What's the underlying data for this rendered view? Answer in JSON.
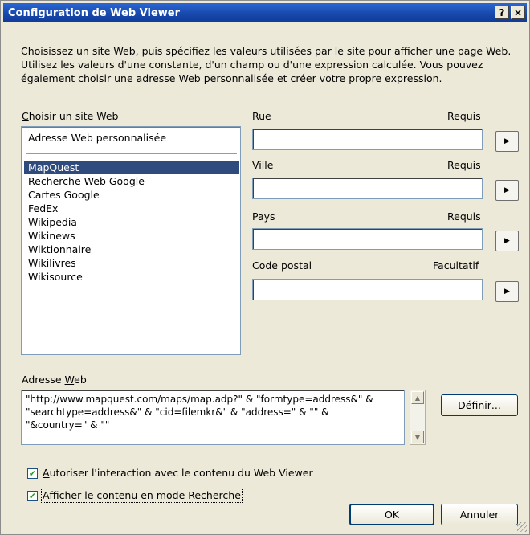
{
  "window": {
    "title": "Configuration de Web Viewer",
    "help_label": "?",
    "close_label": "×"
  },
  "intro": "Choisissez un site Web, puis spécifiez les valeurs utilisées par le site pour afficher une page Web. Utilisez les valeurs d'une constante, d'un champ ou d'une expression calculée. Vous pouvez également choisir une adresse Web personnalisée et créer votre propre expression.",
  "site_list": {
    "label_mnemonic": "C",
    "label_rest": "hoisir un site Web",
    "custom_item": "Adresse Web personnalisée",
    "selected": "MapQuest",
    "items": [
      "MapQuest",
      "Recherche Web Google",
      "Cartes Google",
      "FedEx",
      "Wikipedia",
      "Wikinews",
      "Wiktionnaire",
      "Wikilivres",
      "Wikisource"
    ]
  },
  "fields": [
    {
      "label": "Rue",
      "status": "Requis",
      "value": ""
    },
    {
      "label": "Ville",
      "status": "Requis",
      "value": ""
    },
    {
      "label": "Pays",
      "status": "Requis",
      "value": ""
    },
    {
      "label": "Code postal",
      "status": "Facultatif",
      "value": ""
    }
  ],
  "url": {
    "label_pre": "Adresse ",
    "label_mnemonic": "W",
    "label_post": "eb",
    "line1": "\"http://www.mapquest.com/maps/map.adp?\" & \"formtype=address&\" &",
    "line2": "\"searchtype=address&\" & \"cid=filemkr&\" & \"address=\" & \"\" &",
    "line3": "\"&country=\" & \"\"",
    "define_pre": "Défini",
    "define_mnemonic": "r",
    "define_post": "..."
  },
  "options": {
    "allow_interaction": {
      "checked": true,
      "mnemonic": "A",
      "rest": "utoriser l'interaction avec le contenu du Web Viewer"
    },
    "show_in_find": {
      "checked": true,
      "pre": "Afficher le contenu en mo",
      "mnemonic": "d",
      "post": "e Recherche"
    }
  },
  "buttons": {
    "ok": "OK",
    "cancel": "Annuler"
  },
  "icons": {
    "arrow": "triangle-right-icon",
    "scroll_up": "triangle-up-icon",
    "scroll_down": "triangle-down-icon",
    "check": "checkmark-icon"
  }
}
